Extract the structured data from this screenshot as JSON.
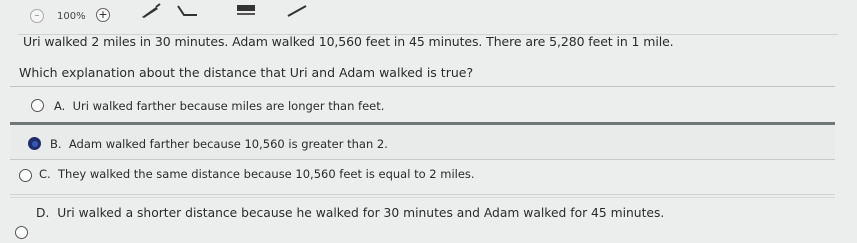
{
  "toolbar": {
    "zoom_level": "100%",
    "zoom_out_icon": "minus-circle-icon",
    "zoom_in_icon": "plus-circle-icon",
    "tools": [
      "pen-icon",
      "line-icon",
      "highlighter-icon",
      "eraser-icon"
    ]
  },
  "question": {
    "stem": "Uri walked 2 miles in 30 minutes. Adam walked 10,560 feet in 45 minutes. There are 5,280 feet in 1 mile.",
    "prompt": "Which explanation about the distance that Uri and Adam walked is true?"
  },
  "options": [
    {
      "letter": "A.",
      "text": "Uri walked farther because miles are longer than feet.",
      "selected": false
    },
    {
      "letter": "B.",
      "text": "Adam walked farther because 10,560 is greater than 2.",
      "selected": true
    },
    {
      "letter": "C.",
      "text": "They walked the same distance because 10,560 feet is equal to 2 miles.",
      "selected": false
    },
    {
      "letter": "D.",
      "text": "Uri walked a shorter distance because he walked for 30 minutes and Adam walked for 45 minutes.",
      "selected": false
    }
  ],
  "colors": {
    "selected_radio": "#1d2f6b",
    "background": "#eceeee"
  }
}
